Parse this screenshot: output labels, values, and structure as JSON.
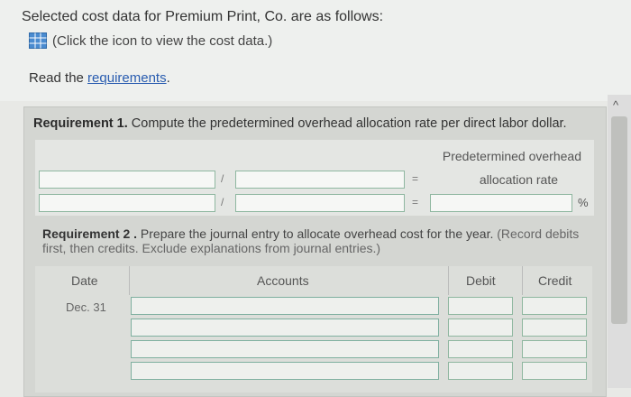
{
  "intro": {
    "title": "Selected cost data for Premium Print, Co. are as follows:",
    "icon_hint": "(Click the icon to view the cost data.)",
    "read_prefix": "Read the ",
    "read_link": "requirements",
    "read_suffix": "."
  },
  "req1": {
    "label": "Requirement 1.",
    "text": " Compute the predetermined overhead allocation rate per direct labor dollar.",
    "result_label_line1": "Predetermined overhead",
    "result_label_line2": "allocation rate",
    "divide_symbol": "/",
    "equals_symbol": "=",
    "percent_symbol": "%"
  },
  "req2": {
    "label": "Requirement 2 .",
    "text": " Prepare the journal entry to allocate overhead cost for the year.",
    "hint": " (Record debits first, then credits. Exclude explanations from journal entries.)"
  },
  "journal": {
    "columns": [
      "Date",
      "Accounts",
      "Debit",
      "Credit"
    ],
    "date": "Dec. 31"
  },
  "icons": {
    "data_table": "grid-table-icon",
    "scroll_up": "chevron-up-icon"
  },
  "colors": {
    "link": "#2a5db0",
    "input_border": "#8fb7a0"
  }
}
